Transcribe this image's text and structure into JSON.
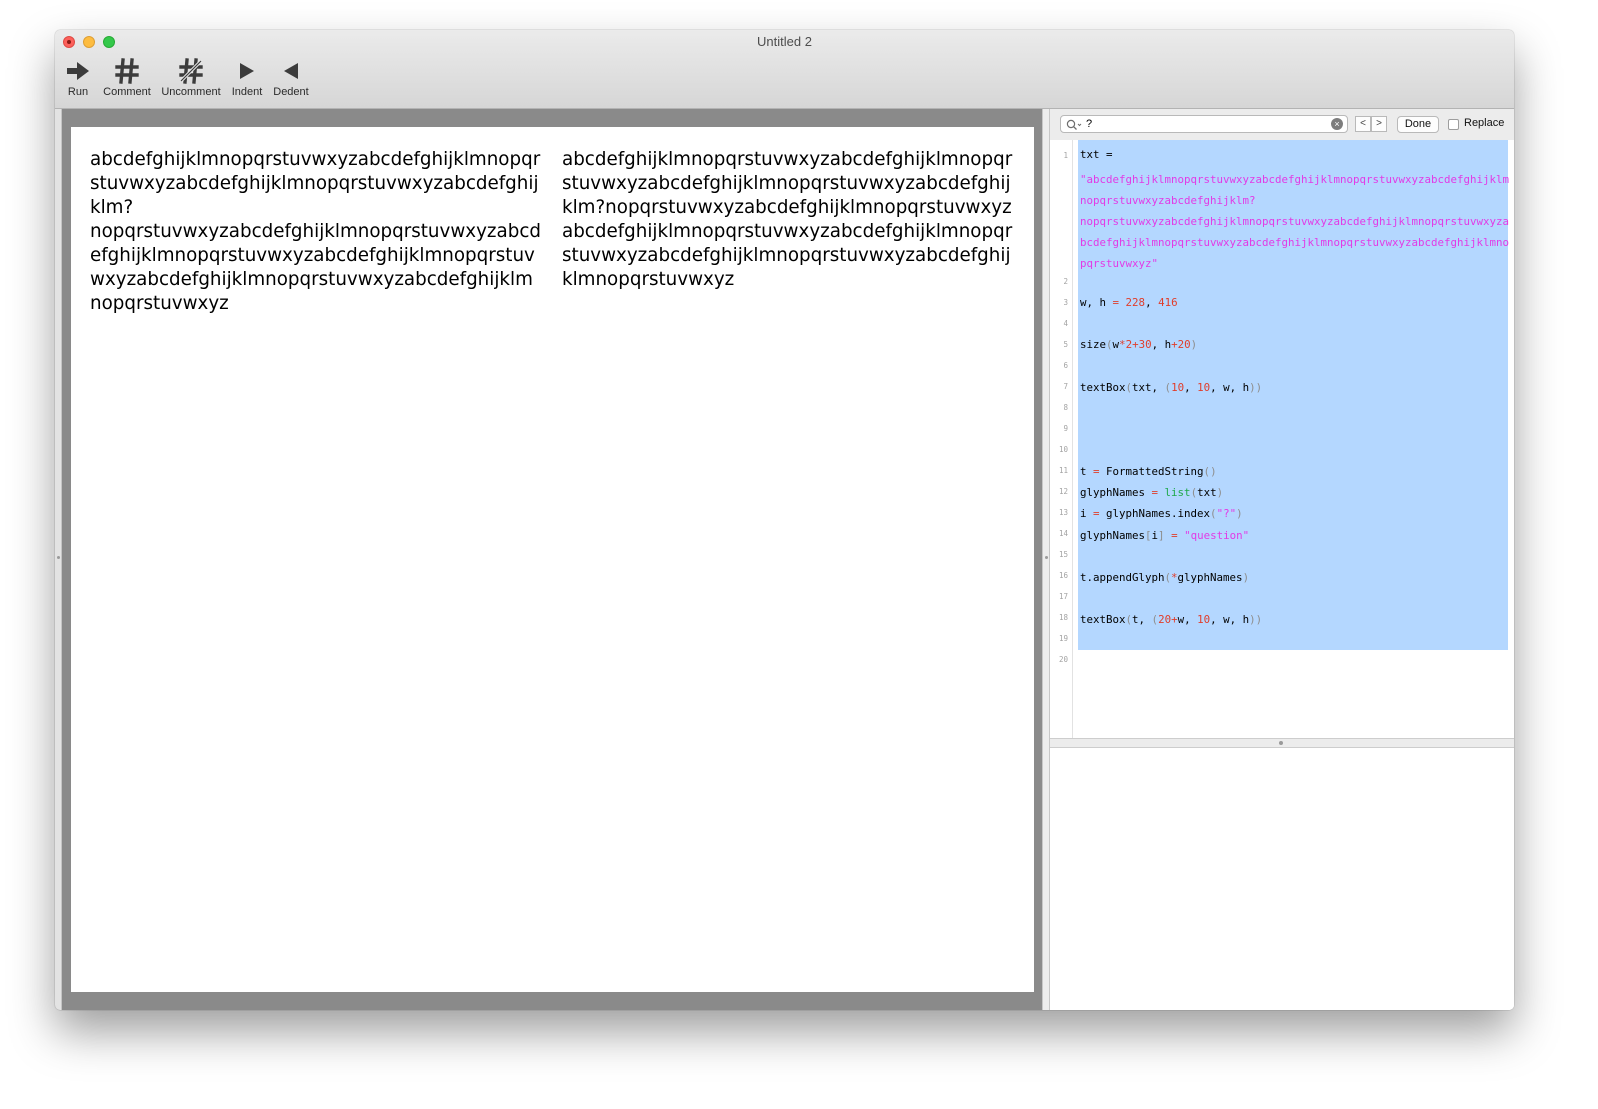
{
  "window": {
    "title": "Untitled 2"
  },
  "toolbar": {
    "items": [
      {
        "label": "Run",
        "icon": "run-arrow-icon"
      },
      {
        "label": "Comment",
        "icon": "hash-icon"
      },
      {
        "label": "Uncomment",
        "icon": "hash-slash-icon"
      },
      {
        "label": "Indent",
        "icon": "triangle-right-icon"
      },
      {
        "label": "Dedent",
        "icon": "triangle-left-icon"
      }
    ]
  },
  "canvas": {
    "column1_text": "abcdefghijklmnopqrstuvwxyzabcdefghijklmnopqrstuvwxyzabcdefghijklmnopqrstuvwxyzabcdefghijklm?\nnopqrstuvwxyzabcdefghijklmnopqrstuvwxyzabcdefghijklmnopqrstuvwxyzabcdefghijklmnopqrstuvwxyzabcdefghijklmnopqrstuvwxyzabcdefghijklmnopqrstuvwxyz",
    "column2_text": "abcdefghijklmnopqrstuvwxyzabcdefghijklmnopqrstuvwxyzabcdefghijklmnopqrstuvwxyzabcdefghijklm?nopqrstuvwxyzabcdefghijklmnopqrstuvwxyzabcdefghijklmnopqrstuvwxyzabcdefghijklmnopqrstuvwxyzabcdefghijklmnopqrstuvwxyzabcdefghijklmnopqrstuvwxyz"
  },
  "find": {
    "query": "?",
    "prev_label": "<",
    "next_label": ">",
    "done_label": "Done",
    "replace_label": "Replace"
  },
  "editor": {
    "line_numbers": [
      "1",
      "2",
      "3",
      "4",
      "5",
      "6",
      "7",
      "8",
      "9",
      "10",
      "11",
      "12",
      "13",
      "14",
      "15",
      "16",
      "17",
      "18",
      "19",
      "20"
    ],
    "lines": [
      "txt =",
      "\"abcdefghijklmnopqrstuvwxyzabcdefghijklmnopqrstuvwxyzabcdefghijklmnopqrstuvwxyzabcdefghijklm?",
      "nopqrstuvwxyzabcdefghijklmnopqrstuvwxyzabcdefghijklmnopqrstuvwxyzabcdefghijklmnopqrstuvwxyzabcdefghijklmnopqrstuvwxyzabcdefghijklmnopqrstuvwxyz\"",
      "",
      "w, h = 228, 416",
      "",
      "size(w*2+30, h+20)",
      "",
      "textBox(txt, (10, 10, w, h))",
      "",
      "",
      "",
      "t = FormattedString()",
      "glyphNames = list(txt)",
      "i = glyphNames.index(\"?\")",
      "glyphNames[i] = \"question\"",
      "",
      "t.appendGlyph(*glyphNames)",
      "",
      "textBox(t, (20+w, 10, w, h))",
      "",
      ""
    ]
  },
  "colors": {
    "selection": "#b4d7ff",
    "string": "#e23be6",
    "number": "#e03d2b",
    "builtin": "#1ea84a",
    "close": "#fc605b",
    "minimize": "#fdbc40",
    "zoom": "#34c84a"
  }
}
